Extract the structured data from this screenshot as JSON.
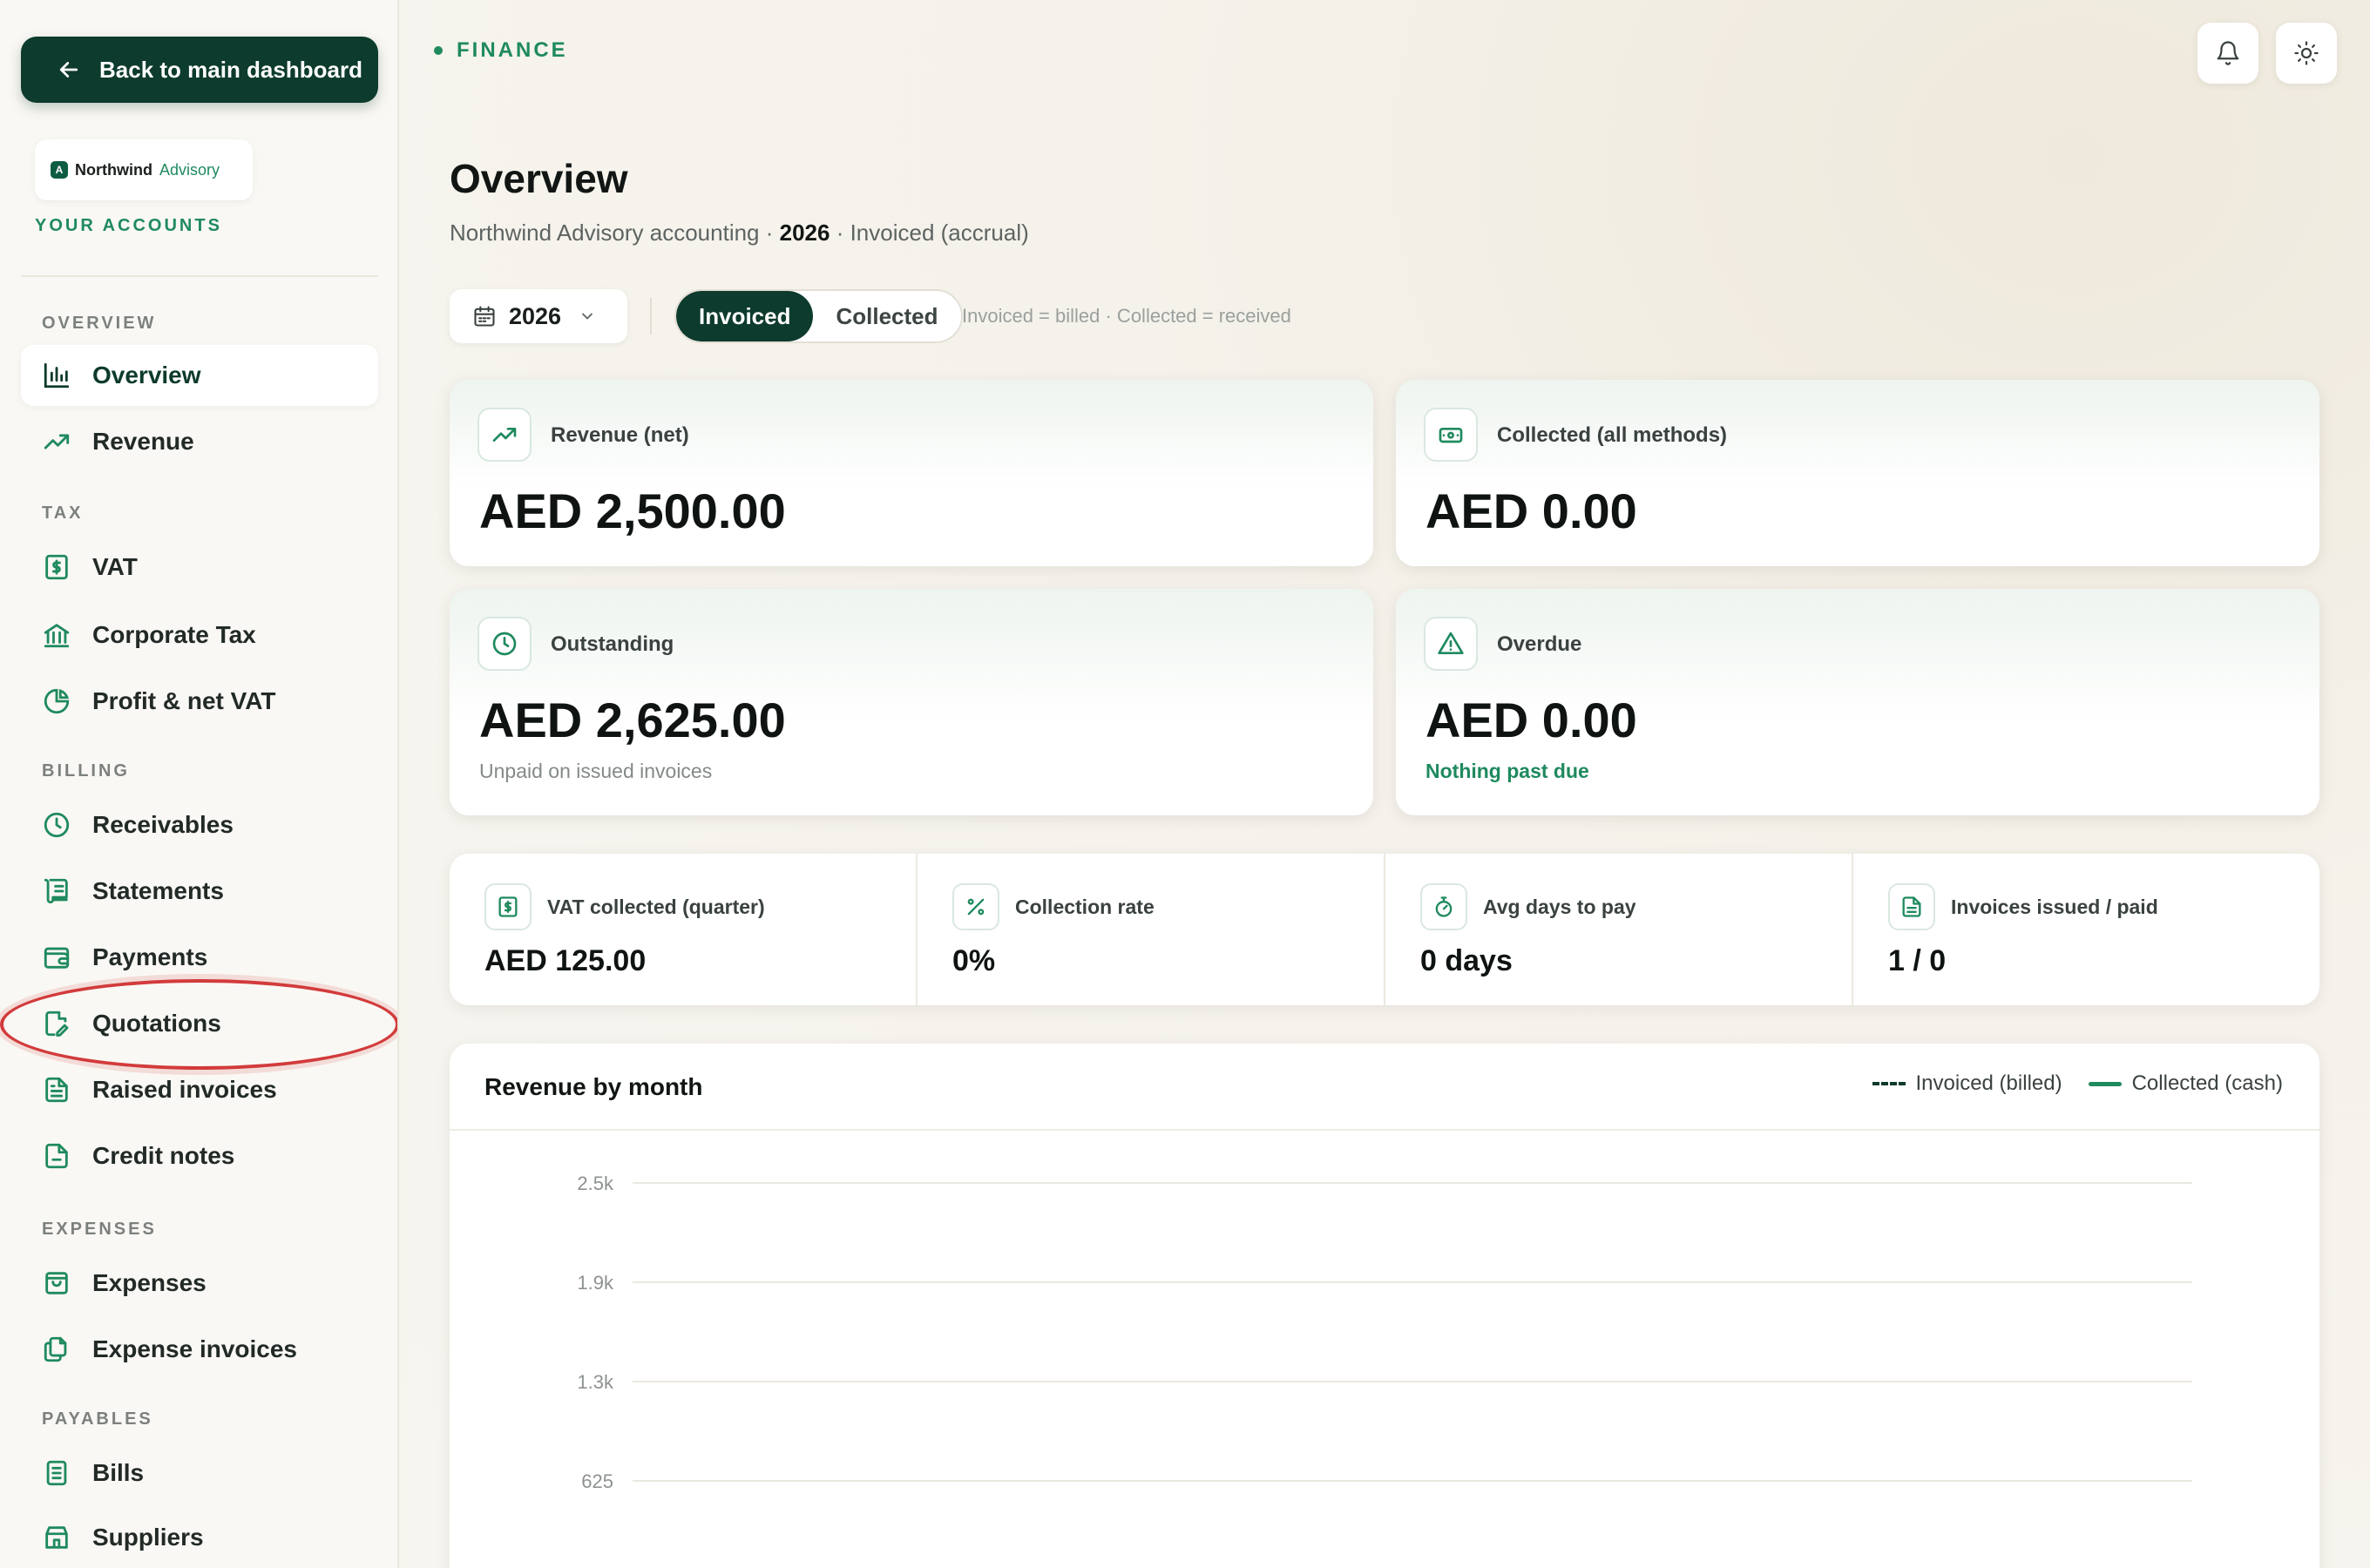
{
  "sidebar": {
    "back_label": "Back to main dashboard",
    "brand": {
      "mark": "A",
      "name": "Northwind",
      "sub": "Advisory"
    },
    "your_accounts": "YOUR ACCOUNTS",
    "sections": [
      {
        "label": "OVERVIEW",
        "items": [
          {
            "label": "Overview",
            "icon": "bar-chart-icon",
            "active": true
          },
          {
            "label": "Revenue",
            "icon": "trend-up-icon"
          }
        ]
      },
      {
        "label": "TAX",
        "items": [
          {
            "label": "VAT",
            "icon": "receipt-dollar-icon"
          },
          {
            "label": "Corporate Tax",
            "icon": "bank-icon"
          },
          {
            "label": "Profit & net VAT",
            "icon": "pie-chart-icon"
          }
        ]
      },
      {
        "label": "BILLING",
        "items": [
          {
            "label": "Receivables",
            "icon": "clock-icon"
          },
          {
            "label": "Statements",
            "icon": "scroll-icon"
          },
          {
            "label": "Payments",
            "icon": "wallet-icon"
          },
          {
            "label": "Quotations",
            "icon": "file-edit-icon"
          },
          {
            "label": "Raised invoices",
            "icon": "file-text-icon"
          },
          {
            "label": "Credit notes",
            "icon": "file-icon"
          }
        ]
      },
      {
        "label": "EXPENSES",
        "items": [
          {
            "label": "Expenses",
            "icon": "shopping-bag-icon"
          },
          {
            "label": "Expense invoices",
            "icon": "files-icon"
          }
        ]
      },
      {
        "label": "PAYABLES",
        "items": [
          {
            "label": "Bills",
            "icon": "receipt-icon"
          },
          {
            "label": "Suppliers",
            "icon": "store-icon"
          }
        ]
      }
    ]
  },
  "header": {
    "crumb": "FINANCE",
    "title": "Overview",
    "subtitle_prefix": "Northwind Advisory accounting · ",
    "subtitle_year": "2026",
    "subtitle_suffix": " · Invoiced (accrual)"
  },
  "filters": {
    "year": "2026",
    "modes": [
      "Invoiced",
      "Collected"
    ],
    "active_mode": "Invoiced",
    "hint": "Invoiced = billed · Collected = received"
  },
  "kpis": {
    "revenue": {
      "label": "Revenue (net)",
      "value": "AED 2,500.00"
    },
    "collected": {
      "label": "Collected (all methods)",
      "value": "AED 0.00"
    },
    "outstanding": {
      "label": "Outstanding",
      "value": "AED 2,625.00",
      "note": "Unpaid on issued invoices"
    },
    "overdue": {
      "label": "Overdue",
      "value": "AED 0.00",
      "note": "Nothing past due"
    }
  },
  "stats": [
    {
      "label": "VAT collected (quarter)",
      "value": "AED 125.00",
      "icon": "receipt-dollar-icon"
    },
    {
      "label": "Collection rate",
      "value": "0%",
      "icon": "percent-icon"
    },
    {
      "label": "Avg days to pay",
      "value": "0 days",
      "icon": "timer-icon"
    },
    {
      "label": "Invoices issued / paid",
      "value": "1 / 0",
      "icon": "file-text-icon"
    }
  ],
  "chart_data": {
    "type": "line",
    "title": "Revenue by month",
    "series": [
      {
        "name": "Invoiced (billed)",
        "style": "dashed",
        "color": "#0d3b2d"
      },
      {
        "name": "Collected (cash)",
        "style": "solid",
        "color": "#1f8a5e"
      }
    ],
    "y_ticks": [
      "2.5k",
      "1.9k",
      "1.3k",
      "625"
    ],
    "ylim": [
      0,
      2500
    ],
    "grid": true,
    "legend": "top-right"
  },
  "colors": {
    "brand": "#0d3b2d",
    "accent": "#1f8a5e",
    "highlight": "#d23b3b"
  }
}
